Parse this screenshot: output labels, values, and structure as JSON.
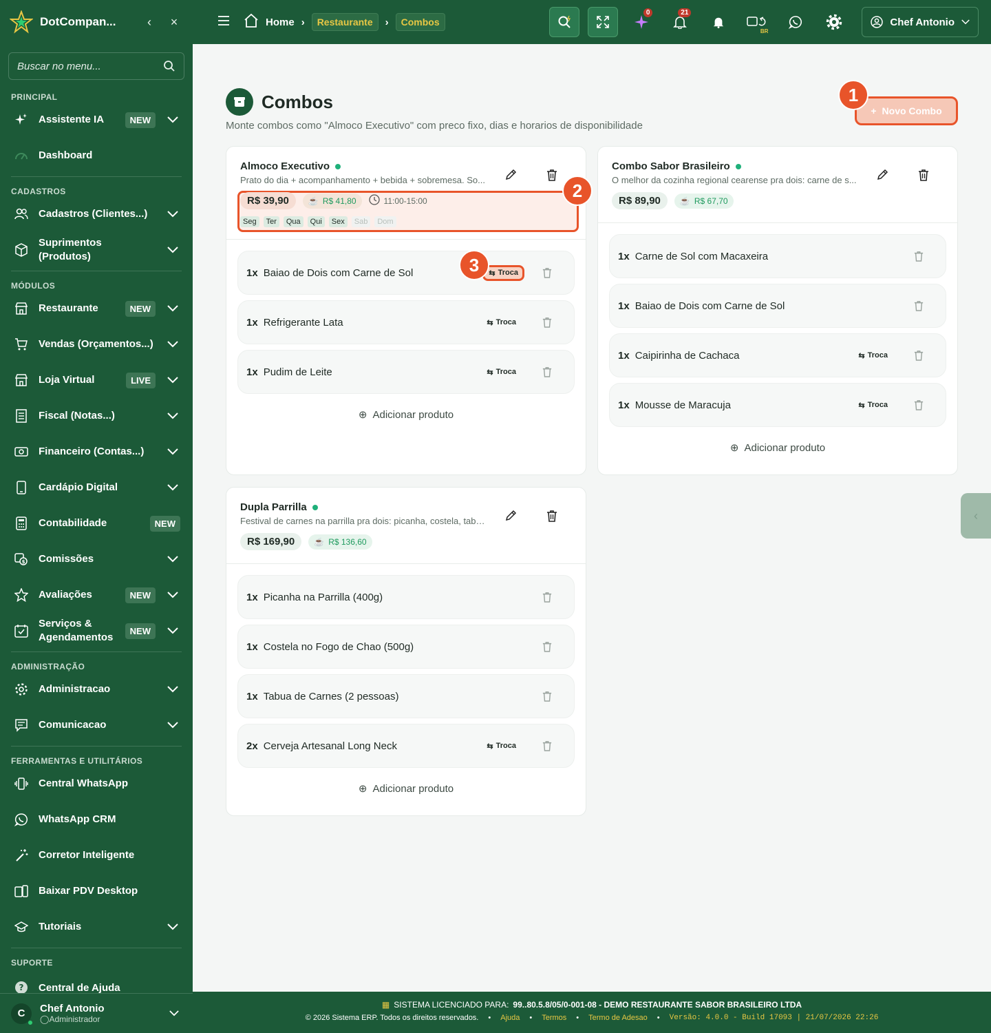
{
  "sidebar": {
    "brand": "DotCompan...",
    "search_placeholder": "Buscar no menu...",
    "sections": {
      "principal": "PRINCIPAL",
      "cadastros": "CADASTROS",
      "modulos": "MÓDULOS",
      "administracao": "ADMINISTRAÇÃO",
      "ferramentas": "FERRAMENTAS E UTILITÁRIOS",
      "suporte": "SUPORTE"
    },
    "items": [
      {
        "label": "Assistente IA",
        "badge": "NEW"
      },
      {
        "label": "Dashboard"
      },
      {
        "label": "Cadastros (Clientes...)"
      },
      {
        "label": "Suprimentos (Produtos)"
      },
      {
        "label": "Restaurante",
        "badge": "NEW"
      },
      {
        "label": "Vendas (Orçamentos...)"
      },
      {
        "label": "Loja Virtual",
        "badge": "LIVE"
      },
      {
        "label": "Fiscal (Notas...)"
      },
      {
        "label": "Financeiro (Contas...)"
      },
      {
        "label": "Cardápio Digital"
      },
      {
        "label": "Contabilidade",
        "badge": "NEW"
      },
      {
        "label": "Comissões"
      },
      {
        "label": "Avaliações",
        "badge": "NEW"
      },
      {
        "label": "Serviços & Agendamentos",
        "badge": "NEW"
      },
      {
        "label": "Administracao"
      },
      {
        "label": "Comunicacao"
      },
      {
        "label": "Central WhatsApp"
      },
      {
        "label": "WhatsApp CRM"
      },
      {
        "label": "Corretor Inteligente"
      },
      {
        "label": "Baixar PDV Desktop"
      },
      {
        "label": "Tutoriais"
      },
      {
        "label": "Central de Ajuda"
      }
    ],
    "user": {
      "initial": "C",
      "name": "Chef Antonio",
      "role": "Administrador"
    }
  },
  "topbar": {
    "breadcrumb": [
      "Home",
      "Restaurante",
      "Combos"
    ],
    "ai_count": "0",
    "notif_count": "21",
    "lang_tag": "BR",
    "user_name": "Chef Antonio"
  },
  "page": {
    "title": "Combos",
    "subtitle": "Monte combos como \"Almoco Executivo\" com preco fixo, dias e horarios de disponibilidade",
    "new_button": "Novo Combo",
    "markers": [
      "1",
      "2",
      "3"
    ],
    "add_product_label": "Adicionar produto",
    "swap_label": "Troca"
  },
  "combos": [
    {
      "name": "Almoco Executivo",
      "description": "Prato do dia + acompanhamento + bebida + sobremesa. So...",
      "price": "R$ 39,90",
      "cost": "R$ 41,80",
      "hours": "11:00-15:00",
      "days": [
        {
          "label": "Seg",
          "active": true
        },
        {
          "label": "Ter",
          "active": true
        },
        {
          "label": "Qua",
          "active": true
        },
        {
          "label": "Qui",
          "active": true
        },
        {
          "label": "Sex",
          "active": true
        },
        {
          "label": "Sab",
          "active": false
        },
        {
          "label": "Dom",
          "active": false
        }
      ],
      "items": [
        {
          "qty": "1x",
          "name": "Baiao de Dois com Carne de Sol",
          "swap": true
        },
        {
          "qty": "1x",
          "name": "Refrigerante Lata",
          "swap": true
        },
        {
          "qty": "1x",
          "name": "Pudim de Leite",
          "swap": true
        }
      ]
    },
    {
      "name": "Combo Sabor Brasileiro",
      "description": "O melhor da cozinha regional cearense pra dois: carne de s...",
      "price": "R$ 89,90",
      "cost": "R$ 67,70",
      "items": [
        {
          "qty": "1x",
          "name": "Carne de Sol com Macaxeira",
          "swap": false
        },
        {
          "qty": "1x",
          "name": "Baiao de Dois com Carne de Sol",
          "swap": false
        },
        {
          "qty": "1x",
          "name": "Caipirinha de Cachaca",
          "swap": true
        },
        {
          "qty": "1x",
          "name": "Mousse de Maracuja",
          "swap": true
        }
      ]
    },
    {
      "name": "Dupla Parrilla",
      "description": "Festival de carnes na parrilla pra dois: picanha, costela, tabu...",
      "price": "R$ 169,90",
      "cost": "R$ 136,60",
      "items": [
        {
          "qty": "1x",
          "name": "Picanha na Parrilla (400g)",
          "swap": false
        },
        {
          "qty": "1x",
          "name": "Costela no Fogo de Chao (500g)",
          "swap": false
        },
        {
          "qty": "1x",
          "name": "Tabua de Carnes (2 pessoas)",
          "swap": false
        },
        {
          "qty": "2x",
          "name": "Cerveja Artesanal Long Neck",
          "swap": true
        }
      ]
    }
  ],
  "footer": {
    "license_prefix": "SISTEMA LICENCIADO PARA:",
    "license_value": "99..80.5.8/05/0-001-08 - DEMO RESTAURANTE SABOR BRASILEIRO LTDA",
    "copyright": "© 2026 Sistema ERP. Todos os direitos reservados.",
    "links": [
      "Ajuda",
      "Termos",
      "Termo de Adesao"
    ],
    "version": "Versão: 4.0.0 - Build 17093 | 21/07/2026 22:26"
  }
}
